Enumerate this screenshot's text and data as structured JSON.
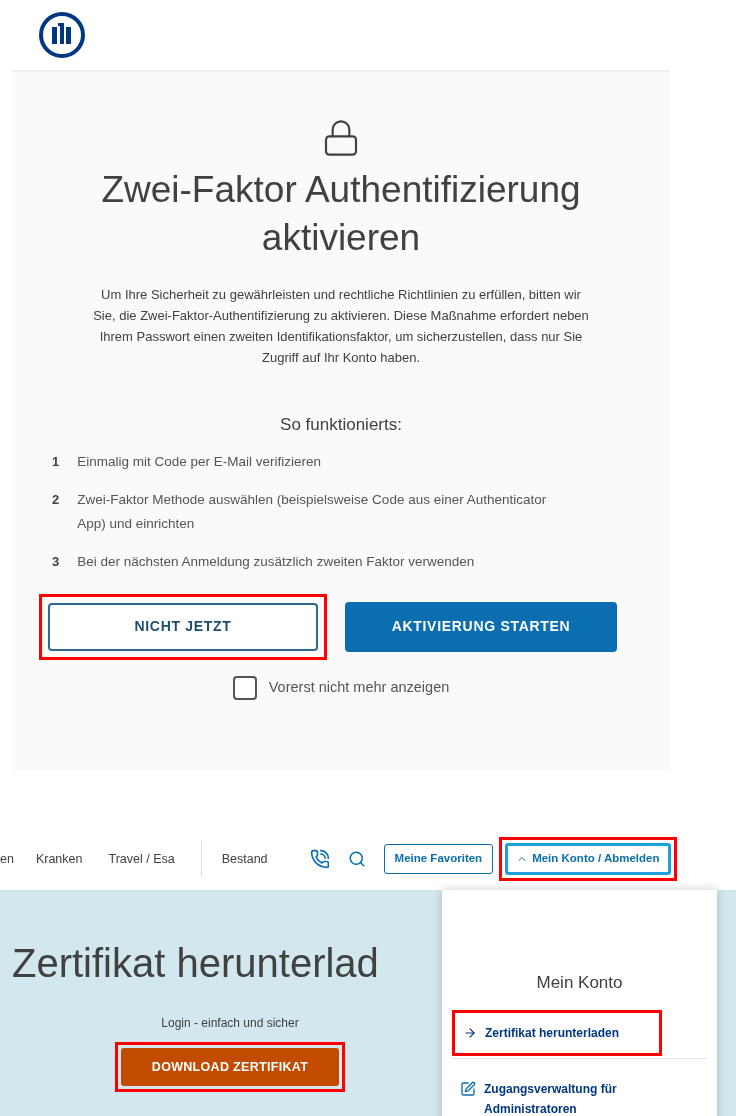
{
  "dialog": {
    "title": "Zwei-Faktor Authentifizierung aktivieren",
    "description": "Um Ihre Sicherheit zu gewährleisten und rechtliche Richtlinien zu erfüllen, bitten wir Sie, die Zwei-Faktor-Authentifizierung zu aktivieren. Diese Maßnahme erfordert neben Ihrem Passwort einen zweiten Identifikationsfaktor, um sicherzustellen, dass nur Sie Zugriff auf Ihr Konto haben.",
    "steps_heading": "So funktionierts:",
    "steps": [
      {
        "number": "1",
        "text": "Einmalig mit Code per E-Mail verifizieren"
      },
      {
        "number": "2",
        "text": "Zwei-Faktor Methode auswählen (beispielsweise Code aus einer Authenticator App) und einrichten"
      },
      {
        "number": "3",
        "text": "Bei der nächsten Anmeldung zusätzlich zweiten Faktor verwenden"
      }
    ],
    "buttons": [
      {
        "label": "NICHT JETZT",
        "kind": "secondary",
        "highlighted": true
      },
      {
        "label": "AKTIVIERUNG STARTEN",
        "kind": "primary",
        "highlighted": false
      }
    ],
    "checkbox": {
      "label": "Vorerst nicht mehr anzeigen",
      "checked": false
    }
  },
  "portal": {
    "nav_items": [
      "en",
      "Kranken",
      "Travel / Esa",
      "Bestand"
    ],
    "favorites_button": {
      "label": "Meine Favoriten"
    },
    "account_button": {
      "label": "Mein Konto / Abmelden",
      "expanded": true,
      "highlighted": true
    },
    "hero_title": "Zertifikat herunterlad",
    "hero_subtitle": "Login - einfach und sicher",
    "download_button": {
      "label": "DOWNLOAD ZERTIFIKAT",
      "highlighted": true
    },
    "menu": {
      "title": "Mein Konto",
      "items": [
        {
          "label": "Zertifikat herunterladen",
          "kind": "arrow",
          "highlighted": true
        },
        {
          "label": "Zugangsverwaltung für Administratoren",
          "kind": "edit",
          "highlighted": false
        }
      ]
    }
  }
}
